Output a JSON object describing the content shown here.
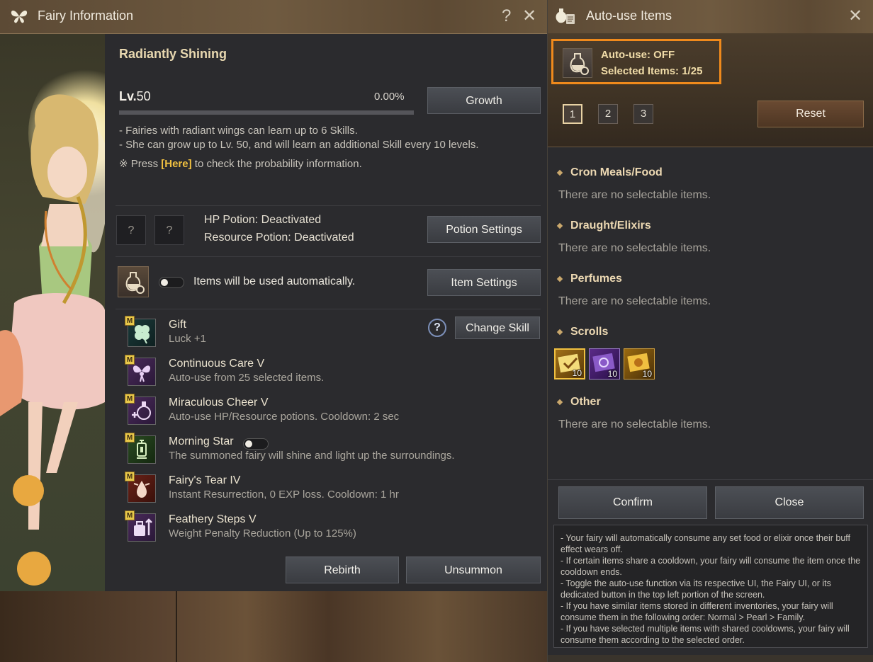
{
  "fairy_window": {
    "title": "Fairy Information",
    "help_icon": "?",
    "close_icon": "✕",
    "fairy_name": "Radiantly Shining",
    "level_prefix": "Lv.",
    "level_value": "50",
    "exp_percent": "0.00%",
    "exp_fraction": 0.0,
    "growth_button": "Growth",
    "desc_line1": "- Fairies with radiant wings can learn up to 6 Skills.",
    "desc_line2": "- She can grow up to Lv. 50, and will learn an additional Skill every 10 levels.",
    "prob_prefix": "※ Press ",
    "prob_link": "[Here]",
    "prob_suffix": " to check the probability information.",
    "slot1": "?",
    "slot2": "?",
    "hp_potion": "HP Potion: Deactivated",
    "resource_potion": "Resource Potion: Deactivated",
    "potion_settings_button": "Potion Settings",
    "auto_use_text": "Items will be used automatically.",
    "item_settings_button": "Item Settings",
    "skill_help": "?",
    "change_skill_button": "Change Skill",
    "skills": [
      {
        "badge": "M",
        "name": "Gift",
        "desc": "Luck +1",
        "icon": "clover-icon"
      },
      {
        "badge": "M",
        "name": "Continuous Care V",
        "desc": "Auto-use from 25 selected items.",
        "icon": "fairy-icon"
      },
      {
        "badge": "M",
        "name": "Miraculous Cheer V",
        "desc": "Auto-use HP/Resource potions. Cooldown: 2 sec",
        "icon": "potion-plus-icon"
      },
      {
        "badge": "M",
        "name": "Morning Star",
        "desc": "The summoned fairy will shine and light up the surroundings.",
        "icon": "lantern-icon"
      },
      {
        "badge": "M",
        "name": "Fairy's Tear IV",
        "desc": "Instant Resurrection, 0 EXP loss. Cooldown: 1 hr",
        "icon": "tear-icon"
      },
      {
        "badge": "M",
        "name": "Feathery Steps V",
        "desc": "Weight Penalty Reduction (Up to 125%)",
        "icon": "weight-icon"
      }
    ],
    "rebirth_button": "Rebirth",
    "unsummon_button": "Unsummon"
  },
  "auto_window": {
    "title": "Auto-use Items",
    "close_icon": "✕",
    "status_line1": "Auto-use: OFF",
    "status_line2": "Selected Items: 1/25",
    "pages": [
      "1",
      "2",
      "3"
    ],
    "active_page": "1",
    "reset_button": "Reset",
    "categories": [
      {
        "name": "Cron Meals/Food",
        "empty_text": "There are no selectable items."
      },
      {
        "name": "Draught/Elixirs",
        "empty_text": "There are no selectable items."
      },
      {
        "name": "Perfumes",
        "empty_text": "There are no selectable items."
      },
      {
        "name": "Scrolls"
      },
      {
        "name": "Other",
        "empty_text": "There are no selectable items."
      }
    ],
    "scroll_items": [
      {
        "count": "10",
        "color": "#d4a22a",
        "selected": true
      },
      {
        "count": "10",
        "color": "#7a3aa8",
        "selected": false
      },
      {
        "count": "10",
        "color": "#d49a20",
        "selected": false
      }
    ],
    "confirm_button": "Confirm",
    "close_button": "Close",
    "notes": [
      "- Your fairy will automatically consume any set food or elixir once their buff effect wears off.",
      "- If certain items share a cooldown, your fairy will consume the item once the cooldown ends.",
      "- Toggle the auto-use function via its respective UI, the Fairy UI, or its dedicated button in the top left portion of the screen.",
      "- If you have similar items stored in different inventories, your fairy will consume them in the following order: Normal > Pearl > Family.",
      "- If you have selected multiple items with shared cooldowns, your fairy will consume them according to the selected order."
    ]
  },
  "colors": {
    "accent_gold": "#e8d8b0",
    "highlight_orange": "#f08a1c",
    "link_yellow": "#f0c040"
  }
}
